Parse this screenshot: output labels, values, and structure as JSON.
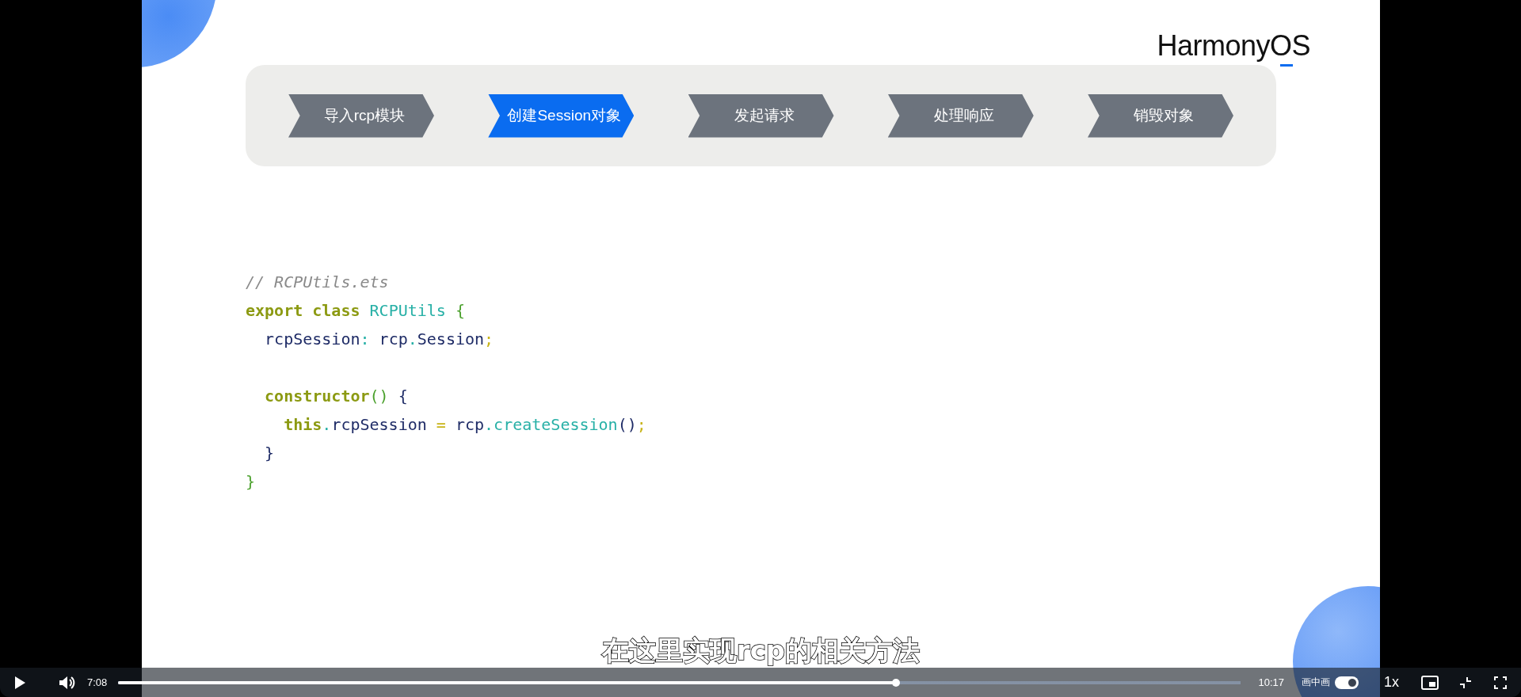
{
  "slide": {
    "logo": "HarmonyOS",
    "steps": [
      {
        "label": "导入rcp模块",
        "selected": false
      },
      {
        "label": "创建Session对象",
        "selected": true
      },
      {
        "label": "发起请求",
        "selected": false
      },
      {
        "label": "处理响应",
        "selected": false
      },
      {
        "label": "销毁对象",
        "selected": false
      }
    ],
    "code_lines": [
      {
        "kind": "code",
        "tokens": [
          {
            "kind": "comment",
            "text": "// RCPUtils.ets"
          }
        ]
      },
      {
        "kind": "code",
        "tokens": [
          {
            "kind": "keyword",
            "text": "export class "
          },
          {
            "kind": "type",
            "text": "RCPUtils"
          },
          {
            "kind": "brace",
            "text": " {"
          }
        ]
      },
      {
        "kind": "code",
        "tokens": [
          {
            "kind": "ident",
            "text": "  rcpSession"
          },
          {
            "kind": "punct",
            "text": ": "
          },
          {
            "kind": "ident",
            "text": "rcp"
          },
          {
            "kind": "punct",
            "text": "."
          },
          {
            "kind": "ident",
            "text": "Session"
          },
          {
            "kind": "semi",
            "text": ";"
          }
        ]
      },
      {
        "kind": "blank"
      },
      {
        "kind": "code",
        "tokens": [
          {
            "kind": "keyword",
            "text": "  constructor"
          },
          {
            "kind": "brace",
            "text": "()"
          },
          {
            "kind": "ident",
            "text": " {"
          }
        ]
      },
      {
        "kind": "code",
        "tokens": [
          {
            "kind": "keyword",
            "text": "    this"
          },
          {
            "kind": "punct",
            "text": "."
          },
          {
            "kind": "ident",
            "text": "rcpSession"
          },
          {
            "kind": "semi",
            "text": " = "
          },
          {
            "kind": "ident",
            "text": "rcp"
          },
          {
            "kind": "punct",
            "text": "."
          },
          {
            "kind": "type",
            "text": "createSession"
          },
          {
            "kind": "ident",
            "text": "()"
          },
          {
            "kind": "semi",
            "text": ";"
          }
        ]
      },
      {
        "kind": "code",
        "tokens": [
          {
            "kind": "ident",
            "text": "  }"
          }
        ]
      },
      {
        "kind": "code",
        "tokens": [
          {
            "kind": "brace",
            "text": "}"
          }
        ]
      }
    ],
    "subtitle": "在这里实现rcp的相关方法"
  },
  "controls": {
    "playing": false,
    "current_time": "7:08",
    "progress": {
      "level": 0.693
    },
    "duration": "10:17",
    "pip_label": "画中画",
    "pip_toggle": {
      "on": true
    },
    "speed": "1x"
  }
}
